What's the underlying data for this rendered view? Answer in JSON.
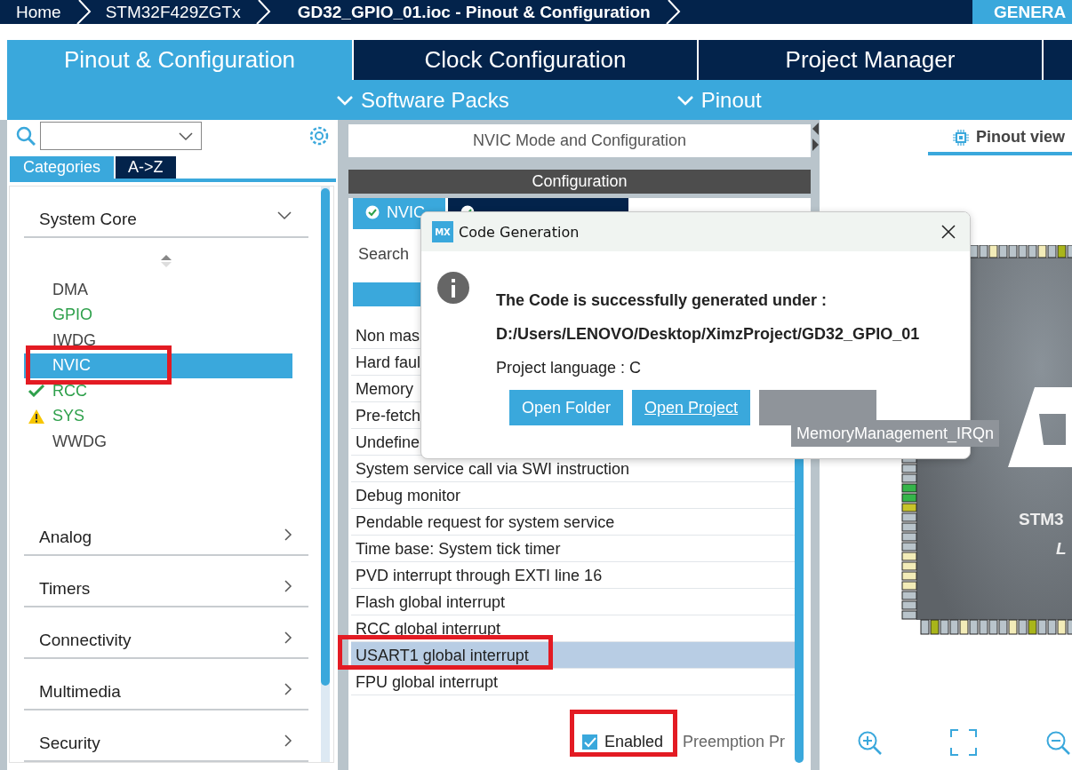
{
  "breadcrumb": [
    {
      "label": "Home",
      "current": false
    },
    {
      "label": "STM32F429ZGTx",
      "current": false
    },
    {
      "label": "GD32_GPIO_01.ioc - Pinout & Configuration",
      "current": true
    }
  ],
  "generate_button": "GENERA",
  "main_tabs": [
    {
      "label": "Pinout & Configuration",
      "selected": true
    },
    {
      "label": "Clock Configuration",
      "selected": false
    },
    {
      "label": "Project Manager",
      "selected": false
    }
  ],
  "sub_menus": [
    "Software Packs",
    "Pinout"
  ],
  "left_panel": {
    "view_tabs": [
      {
        "label": "Categories",
        "selected": true
      },
      {
        "label": "A->Z",
        "selected": false
      }
    ],
    "categories": [
      {
        "label": "System Core",
        "expanded": true,
        "children": [
          {
            "label": "DMA",
            "kind": "plain",
            "configured": false,
            "selected": false,
            "highlighted": false
          },
          {
            "label": "GPIO",
            "kind": "plain",
            "configured": true,
            "selected": false,
            "highlighted": false
          },
          {
            "label": "IWDG",
            "kind": "plain",
            "configured": false,
            "selected": false,
            "highlighted": false
          },
          {
            "label": "NVIC",
            "kind": "plain",
            "configured": false,
            "selected": true,
            "highlighted": true
          },
          {
            "label": "RCC",
            "kind": "checked",
            "configured": true,
            "selected": false,
            "highlighted": false
          },
          {
            "label": "SYS",
            "kind": "warning",
            "configured": true,
            "selected": false,
            "highlighted": false
          },
          {
            "label": "WWDG",
            "kind": "plain",
            "configured": false,
            "selected": false,
            "highlighted": false
          }
        ]
      },
      {
        "label": "Analog",
        "expanded": false
      },
      {
        "label": "Timers",
        "expanded": false
      },
      {
        "label": "Connectivity",
        "expanded": false
      },
      {
        "label": "Multimedia",
        "expanded": false
      },
      {
        "label": "Security",
        "expanded": false
      }
    ]
  },
  "middle_panel": {
    "title": "NVIC Mode and Configuration",
    "config_header": "Configuration",
    "tabs": [
      {
        "label": "NVIC",
        "selected": true
      },
      {
        "selected": false
      }
    ],
    "search_label": "Search",
    "interrupts": [
      {
        "name": "Non mas",
        "selected": false,
        "highlighted": false
      },
      {
        "name": "Hard faul",
        "selected": false,
        "highlighted": false
      },
      {
        "name": "Memory",
        "selected": false,
        "highlighted": false
      },
      {
        "name": "Pre-fetch",
        "selected": false,
        "highlighted": false
      },
      {
        "name": "Undefine",
        "selected": false,
        "highlighted": false
      },
      {
        "name": "System service call via SWI instruction",
        "selected": false,
        "highlighted": false
      },
      {
        "name": "Debug monitor",
        "selected": false,
        "highlighted": false
      },
      {
        "name": "Pendable request for system service",
        "selected": false,
        "highlighted": false
      },
      {
        "name": "Time base: System tick timer",
        "selected": false,
        "highlighted": false
      },
      {
        "name": "PVD interrupt through EXTI line 16",
        "selected": false,
        "highlighted": false
      },
      {
        "name": "Flash global interrupt",
        "selected": false,
        "highlighted": false
      },
      {
        "name": "RCC global interrupt",
        "selected": false,
        "highlighted": false
      },
      {
        "name": "USART1 global interrupt",
        "selected": true,
        "highlighted": true
      },
      {
        "name": "FPU global interrupt",
        "selected": false,
        "highlighted": false
      }
    ],
    "enabled_checkbox": {
      "label": "Enabled",
      "checked": true,
      "highlighted": true
    },
    "preemption_label": "Preemption Pr"
  },
  "right_panel": {
    "view_tab": "Pinout view",
    "chip": {
      "label": "STM3",
      "sublabel": "L"
    }
  },
  "dialog": {
    "title": "Code Generation",
    "app_badge": "MX",
    "message": "The Code is successfully generated under :",
    "path": "D:/Users/LENOVO/Desktop/XimzProject/GD32_GPIO_01",
    "language": "Project language : C",
    "buttons": [
      {
        "kind": "text",
        "label": "Open Folder",
        "focused": false
      },
      {
        "kind": "text",
        "label": "Open Project",
        "focused": true
      },
      {
        "kind": "covered"
      }
    ]
  },
  "tooltip": "MemoryManagement_IRQn"
}
